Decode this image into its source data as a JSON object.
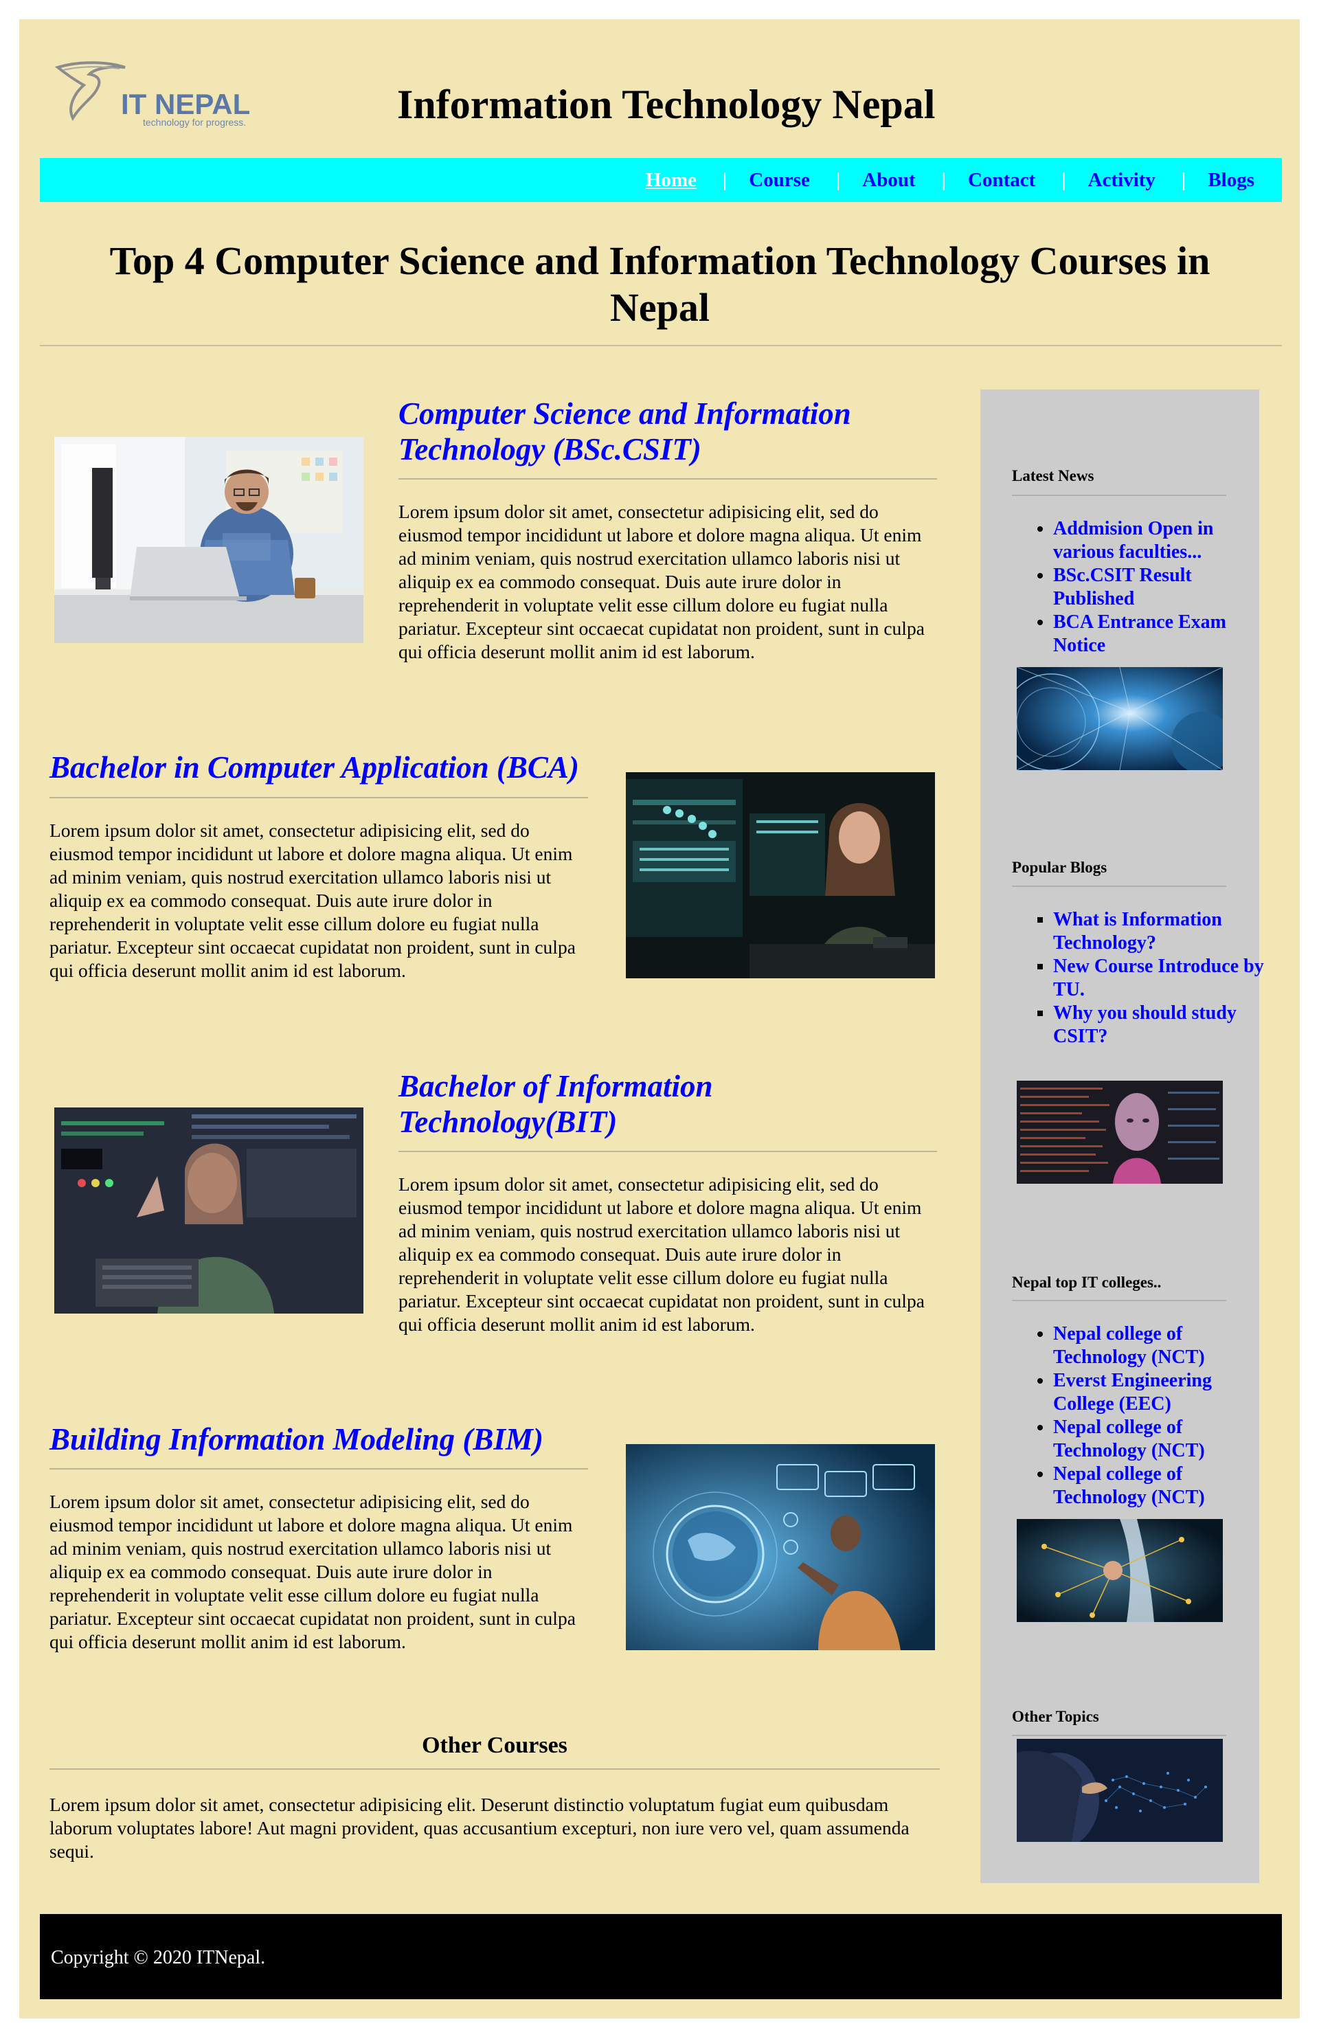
{
  "logo": {
    "name": "IT NEPAL",
    "tagline": "technology for progress."
  },
  "site_title": "Information Technology Nepal",
  "nav": {
    "items": [
      "Home",
      "Course",
      "About",
      "Contact",
      "Activity",
      "Blogs"
    ],
    "active": "Home",
    "separator": "|"
  },
  "page_heading": "Top 4 Computer Science and Information Technology Courses in Nepal",
  "articles": [
    {
      "title": "Computer Science and Information Technology (BSc.CSIT)",
      "body": "Lorem ipsum dolor sit amet, consectetur adipisicing elit, sed do eiusmod tempor incididunt ut labore et dolore magna aliqua. Ut enim ad minim veniam, quis nostrud exercitation ullamco laboris nisi ut aliquip ex ea commodo consequat. Duis aute irure dolor in reprehenderit in voluptate velit esse cillum dolore eu fugiat nulla pariatur. Excepteur sint occaecat cupidatat non proident, sunt in culpa qui officia deserunt mollit anim id est laborum."
    },
    {
      "title": "Bachelor in Computer Application (BCA)",
      "body": "Lorem ipsum dolor sit amet, consectetur adipisicing elit, sed do eiusmod tempor incididunt ut labore et dolore magna aliqua. Ut enim ad minim veniam, quis nostrud exercitation ullamco laboris nisi ut aliquip ex ea commodo consequat. Duis aute irure dolor in reprehenderit in voluptate velit esse cillum dolore eu fugiat nulla pariatur. Excepteur sint occaecat cupidatat non proident, sunt in culpa qui officia deserunt mollit anim id est laborum."
    },
    {
      "title": "Bachelor of Information Technology(BIT)",
      "body": "Lorem ipsum dolor sit amet, consectetur adipisicing elit, sed do eiusmod tempor incididunt ut labore et dolore magna aliqua. Ut enim ad minim veniam, quis nostrud exercitation ullamco laboris nisi ut aliquip ex ea commodo consequat. Duis aute irure dolor in reprehenderit in voluptate velit esse cillum dolore eu fugiat nulla pariatur. Excepteur sint occaecat cupidatat non proident, sunt in culpa qui officia deserunt mollit anim id est laborum."
    },
    {
      "title": "Building Information Modeling (BIM)",
      "body": "Lorem ipsum dolor sit amet, consectetur adipisicing elit, sed do eiusmod tempor incididunt ut labore et dolore magna aliqua. Ut enim ad minim veniam, quis nostrud exercitation ullamco laboris nisi ut aliquip ex ea commodo consequat. Duis aute irure dolor in reprehenderit in voluptate velit esse cillum dolore eu fugiat nulla pariatur. Excepteur sint occaecat cupidatat non proident, sunt in culpa qui officia deserunt mollit anim id est laborum."
    }
  ],
  "other_courses": {
    "title": "Other Courses",
    "body": "Lorem ipsum dolor sit amet, consectetur adipisicing elit. Deserunt distinctio voluptatum fugiat eum quibusdam laborum voluptates labore! Aut magni provident, quas accusantium excepturi, non iure vero vel, quam assumenda sequi."
  },
  "sidebar": {
    "latest_news": {
      "title": "Latest News",
      "items": [
        "Addmision Open in various faculties...",
        "BSc.CSIT Result Published",
        "BCA Entrance Exam Notice"
      ]
    },
    "popular_blogs": {
      "title": "Popular Blogs",
      "items": [
        "What is Information Technology?",
        "New Course Introduce by TU.",
        "Why you should study CSIT?"
      ]
    },
    "top_colleges": {
      "title": "Nepal top IT colleges..",
      "items": [
        "Nepal college of Technology (NCT)",
        "Everst Engineering College (EEC)",
        "Nepal college of Technology (NCT)",
        "Nepal college of Technology (NCT)"
      ]
    },
    "other_topics": {
      "title": "Other Topics"
    }
  },
  "footer": {
    "copyright": "Copyright © 2020 ITNepal."
  },
  "colors": {
    "page_bg": "#f2e6b5",
    "nav_bg": "#00ffff",
    "link": "#0000ff",
    "sidebar_bg": "#cccccc",
    "footer_bg": "#000000"
  }
}
